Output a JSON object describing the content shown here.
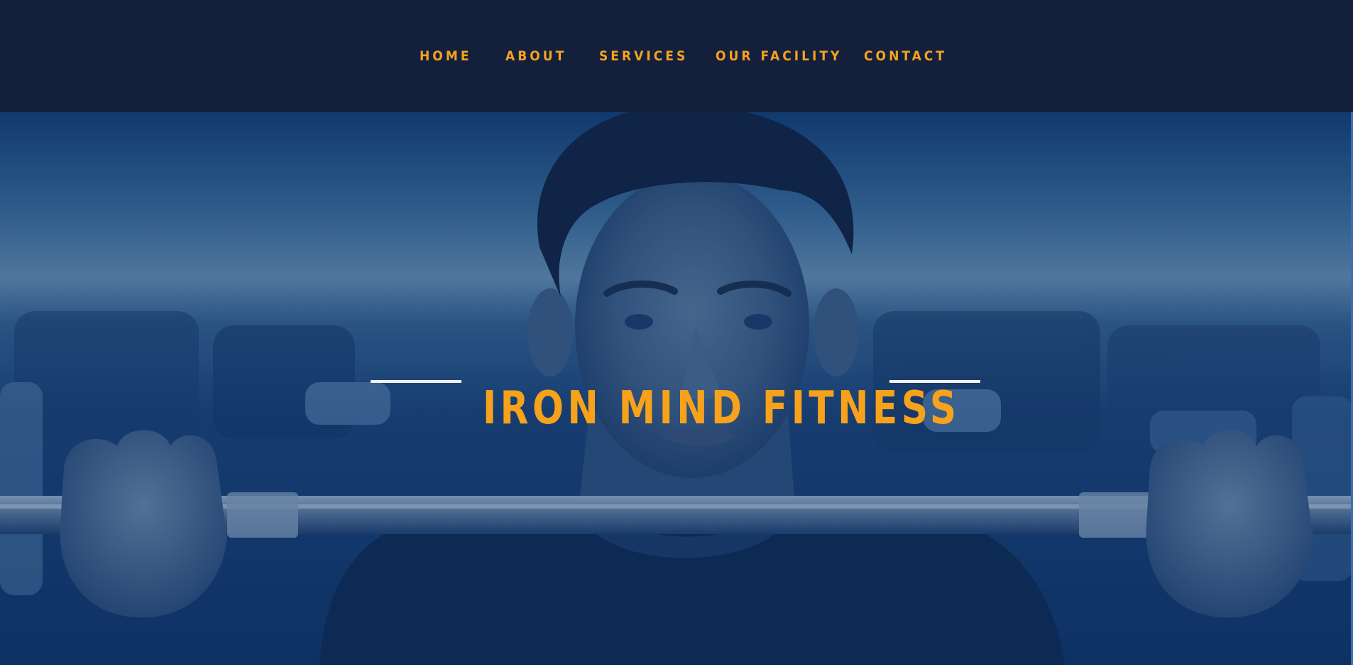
{
  "nav": {
    "items": [
      {
        "label": "HOME"
      },
      {
        "label": "ABOUT"
      },
      {
        "label": "SERVICES"
      },
      {
        "label": "OUR FACILITY"
      },
      {
        "label": "CONTACT"
      }
    ]
  },
  "hero": {
    "title": "IRON MIND FITNESS"
  },
  "colors": {
    "nav_background": "#141f3c",
    "accent": "#f7a21b",
    "overlay": "#0d3a78",
    "rule": "#f2f2f2"
  }
}
